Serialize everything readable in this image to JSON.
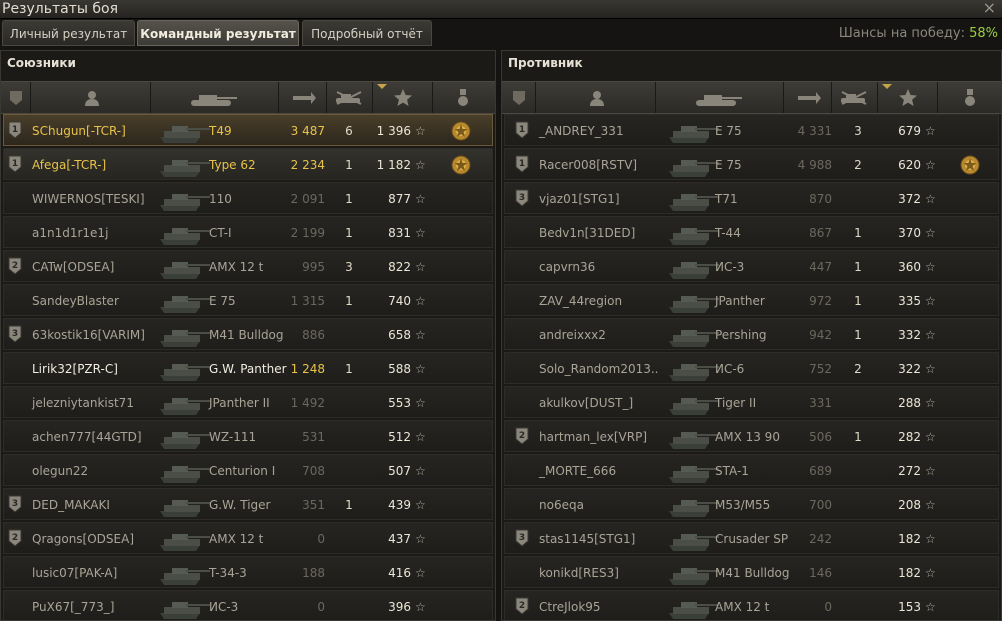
{
  "window": {
    "title": "Результаты боя",
    "close_label": "×"
  },
  "tabs": [
    {
      "label": "Личный результат",
      "active": false
    },
    {
      "label": "Командный результат",
      "active": true
    },
    {
      "label": "Подробный отчёт",
      "active": false
    }
  ],
  "win_chance": {
    "label": "Шансы на победу:",
    "value": "58%"
  },
  "allies": {
    "title": "Союзники",
    "rows": [
      {
        "rank": "1",
        "name": "SChugun[-TCR-]",
        "tank": "T49",
        "damage": "3 487",
        "kills": "6",
        "xp": "1 396",
        "medal": true,
        "style": "me"
      },
      {
        "rank": "1",
        "name": "Afega[-TCR-]",
        "tank": "Type 62",
        "damage": "2 234",
        "kills": "1",
        "xp": "1 182",
        "medal": true,
        "style": "plat"
      },
      {
        "rank": "",
        "name": "WIWERNOS[TESKI]",
        "tank": "110",
        "damage": "2 091",
        "kills": "1",
        "xp": "877",
        "medal": false,
        "style": ""
      },
      {
        "rank": "",
        "name": "a1n1d1r1e1j",
        "tank": "CT-I",
        "damage": "2 199",
        "kills": "1",
        "xp": "831",
        "medal": false,
        "style": ""
      },
      {
        "rank": "2",
        "name": "CATw[ODSEA]",
        "tank": "AMX 12 t",
        "damage": "995",
        "kills": "3",
        "xp": "822",
        "medal": false,
        "style": ""
      },
      {
        "rank": "",
        "name": "SandeyBlaster",
        "tank": "E 75",
        "damage": "1 315",
        "kills": "1",
        "xp": "740",
        "medal": false,
        "style": ""
      },
      {
        "rank": "3",
        "name": "63kostik16[VARIM]",
        "tank": "M41 Bulldog",
        "damage": "886",
        "kills": "",
        "xp": "658",
        "medal": false,
        "style": ""
      },
      {
        "rank": "",
        "name": "Lirik32[PZR-C]",
        "tank": "G.W. Panther",
        "damage": "1 248",
        "kills": "1",
        "xp": "588",
        "medal": false,
        "style": "self"
      },
      {
        "rank": "",
        "name": "jelezniytankist71",
        "tank": "JPanther II",
        "damage": "1 492",
        "kills": "",
        "xp": "553",
        "medal": false,
        "style": ""
      },
      {
        "rank": "",
        "name": "achen777[44GTD]",
        "tank": "WZ-111",
        "damage": "531",
        "kills": "",
        "xp": "512",
        "medal": false,
        "style": ""
      },
      {
        "rank": "",
        "name": "olegun22",
        "tank": "Centurion I",
        "damage": "708",
        "kills": "",
        "xp": "507",
        "medal": false,
        "style": ""
      },
      {
        "rank": "3",
        "name": "DED_MAKAKI",
        "tank": "G.W. Tiger",
        "damage": "351",
        "kills": "1",
        "xp": "439",
        "medal": false,
        "style": ""
      },
      {
        "rank": "2",
        "name": "Qragons[ODSEA]",
        "tank": "AMX 12 t",
        "damage": "0",
        "kills": "",
        "xp": "437",
        "medal": false,
        "style": ""
      },
      {
        "rank": "",
        "name": "lusic07[PAK-A]",
        "tank": "T-34-3",
        "damage": "188",
        "kills": "",
        "xp": "416",
        "medal": false,
        "style": ""
      },
      {
        "rank": "",
        "name": "PuX67[_773_]",
        "tank": "ИС-3",
        "damage": "0",
        "kills": "",
        "xp": "396",
        "medal": false,
        "style": ""
      }
    ]
  },
  "enemies": {
    "title": "Противник",
    "rows": [
      {
        "rank": "1",
        "name": "_ANDREY_331",
        "tank": "E 75",
        "damage": "4 331",
        "kills": "3",
        "xp": "679",
        "medal": false
      },
      {
        "rank": "1",
        "name": "Racer008[RSTV]",
        "tank": "E 75",
        "damage": "4 988",
        "kills": "2",
        "xp": "620",
        "medal": true
      },
      {
        "rank": "3",
        "name": "vjaz01[STG1]",
        "tank": "T71",
        "damage": "870",
        "kills": "",
        "xp": "372",
        "medal": false
      },
      {
        "rank": "",
        "name": "Bedv1n[31DED]",
        "tank": "T-44",
        "damage": "867",
        "kills": "1",
        "xp": "370",
        "medal": false
      },
      {
        "rank": "",
        "name": "capvrn36",
        "tank": "ИС-3",
        "damage": "447",
        "kills": "1",
        "xp": "360",
        "medal": false
      },
      {
        "rank": "",
        "name": "ZAV_44region",
        "tank": "JPanther",
        "damage": "972",
        "kills": "1",
        "xp": "335",
        "medal": false
      },
      {
        "rank": "",
        "name": "andreixxx2",
        "tank": "Pershing",
        "damage": "942",
        "kills": "1",
        "xp": "332",
        "medal": false
      },
      {
        "rank": "",
        "name": "Solo_Random2013..",
        "tank": "ИС-6",
        "damage": "752",
        "kills": "2",
        "xp": "322",
        "medal": false
      },
      {
        "rank": "",
        "name": "akulkov[DUST_]",
        "tank": "Tiger II",
        "damage": "331",
        "kills": "",
        "xp": "288",
        "medal": false
      },
      {
        "rank": "2",
        "name": "hartman_lex[VRP]",
        "tank": "AMX 13 90",
        "damage": "506",
        "kills": "1",
        "xp": "282",
        "medal": false
      },
      {
        "rank": "",
        "name": "_MORTE_666",
        "tank": "STA-1",
        "damage": "689",
        "kills": "",
        "xp": "272",
        "medal": false
      },
      {
        "rank": "",
        "name": "no6eqa",
        "tank": "M53/M55",
        "damage": "700",
        "kills": "",
        "xp": "208",
        "medal": false
      },
      {
        "rank": "3",
        "name": "stas1145[STG1]",
        "tank": "Crusader SP",
        "damage": "242",
        "kills": "",
        "xp": "182",
        "medal": false
      },
      {
        "rank": "",
        "name": "konikd[RES3]",
        "tank": "M41 Bulldog",
        "damage": "146",
        "kills": "",
        "xp": "182",
        "medal": false
      },
      {
        "rank": "2",
        "name": "CtreJlok95",
        "tank": "AMX 12 t",
        "damage": "0",
        "kills": "",
        "xp": "153",
        "medal": false
      }
    ]
  },
  "star_glyph": "☆",
  "colors": {
    "gold": "#e8c34a",
    "chance": "#9ccf3f"
  }
}
